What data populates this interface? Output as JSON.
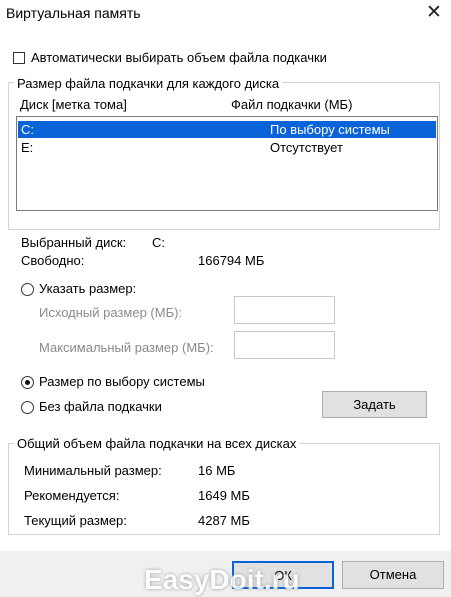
{
  "window": {
    "title": "Виртуальная память",
    "close_glyph": "✕"
  },
  "auto_checkbox_label": "Автоматически выбирать объем файла подкачки",
  "per_disk_group": {
    "legend": "Размер файла подкачки для каждого диска",
    "col_disk": "Диск [метка тома]",
    "col_pagefile": "Файл подкачки (МБ)",
    "rows": [
      {
        "disk": "C:",
        "pagefile": "По выбору системы",
        "selected": true
      },
      {
        "disk": "E:",
        "pagefile": "Отсутствует",
        "selected": false
      }
    ]
  },
  "selected_disk": {
    "label": "Выбранный диск:",
    "value": "C:"
  },
  "free_space": {
    "label": "Свободно:",
    "value": "166794 МБ"
  },
  "options": {
    "custom_size": "Указать размер:",
    "initial_size_label": "Исходный размер (МБ):",
    "max_size_label": "Максимальный размер (МБ):",
    "system_managed": "Размер по выбору системы",
    "no_pagefile": "Без файла подкачки",
    "set_button": "Задать"
  },
  "total_group": {
    "legend": "Общий объем файла подкачки на всех дисках",
    "min_label": "Минимальный размер:",
    "min_value": "16 МБ",
    "recommended_label": "Рекомендуется:",
    "recommended_value": "1649 МБ",
    "current_label": "Текущий размер:",
    "current_value": "4287 МБ"
  },
  "footer": {
    "ok_label": "ОК",
    "cancel_label": "Отмена"
  },
  "watermark": "EasyDoit.ru"
}
